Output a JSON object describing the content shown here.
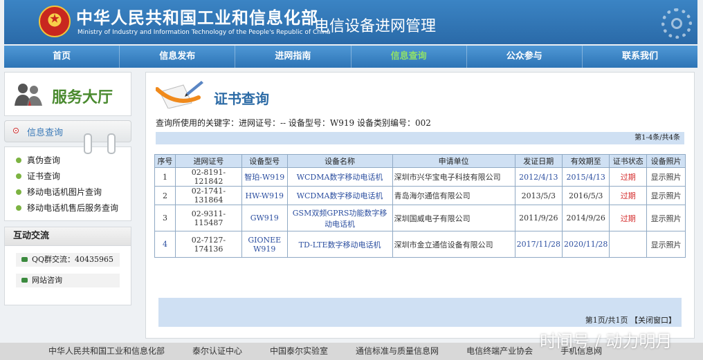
{
  "header": {
    "ministry_cn": "中华人民共和国工业和信息化部",
    "ministry_en": "Ministry of Industry and Information Technology of the People's Republic of China",
    "site_title": "电信设备进网管理"
  },
  "nav": {
    "items": [
      {
        "label": "首页"
      },
      {
        "label": "信息发布"
      },
      {
        "label": "进网指南"
      },
      {
        "label": "信息查询"
      },
      {
        "label": "公众参与"
      },
      {
        "label": "联系我们"
      }
    ],
    "active_color": "#8fe06a"
  },
  "sidebar": {
    "hall_title": "服务大厅",
    "info_tab": "信息查询",
    "menu": [
      {
        "label": "真伪查询"
      },
      {
        "label": "证书查询"
      },
      {
        "label": "移动电话机图片查询"
      },
      {
        "label": "移动电话机售后服务查询"
      }
    ],
    "contact_title": "互动交流",
    "contact_items": [
      {
        "label": "QQ群交流：40435965"
      },
      {
        "label": "网站咨询"
      }
    ]
  },
  "main": {
    "title": "证书查询",
    "keyword": "查询所使用的关键字：进网证号：-- 设备型号：W919 设备类别编号：002",
    "pager_top": "第1-4条/共4条",
    "columns": [
      "序号",
      "进网证号",
      "设备型号",
      "设备名称",
      "申请单位",
      "发证日期",
      "有效期至",
      "证书状态",
      "设备照片"
    ],
    "rows": [
      {
        "no": "1",
        "cert": "02-8191-121842",
        "model": "智珀-W919",
        "name": "WCDMA数字移动电话机",
        "company": "深圳市兴华宝电子科技有限公司",
        "issued": "2012/4/13",
        "valid": "2015/4/13",
        "status": "过期",
        "photo": "显示照片"
      },
      {
        "no": "2",
        "cert": "02-1741-131864",
        "model": "HW-W919",
        "name": "WCDMA数字移动电话机",
        "company": "青岛海尔通信有限公司",
        "issued": "2013/5/3",
        "valid": "2016/5/3",
        "status": "过期",
        "photo": "显示照片"
      },
      {
        "no": "3",
        "cert": "02-9311-115487",
        "model": "GW919",
        "name": "GSM双频GPRS功能数字移动电话机",
        "company": "深圳国威电子有限公司",
        "issued": "2011/9/26",
        "valid": "2014/9/26",
        "status": "过期",
        "photo": "显示照片"
      },
      {
        "no": "4",
        "cert": "02-7127-174136",
        "model": "GIONEE W919",
        "name": "TD-LTE数字移动电话机",
        "company": "深圳市金立通信设备有限公司",
        "issued": "2017/11/28",
        "valid": "2020/11/28",
        "status": "",
        "photo": "显示照片"
      }
    ],
    "pager_bottom": "第1页/共1页 【关闭窗口】"
  },
  "bottom_links": [
    {
      "label": "中华人民共和国工业和信息化部"
    },
    {
      "label": "泰尔认证中心"
    },
    {
      "label": "中国泰尔实验室"
    },
    {
      "label": "通信标准与质量信息网"
    },
    {
      "label": "电信终端产业协会"
    },
    {
      "label": "手机信息网"
    }
  ],
  "watermark": "时间号 / 动力明月",
  "colors": {
    "header_blue": "#2a6aa8",
    "table_header": "#cfe0f3",
    "expired_red": "#d42b2b",
    "link_blue": "#2c4fa0",
    "hall_green": "#4a8a2f"
  }
}
